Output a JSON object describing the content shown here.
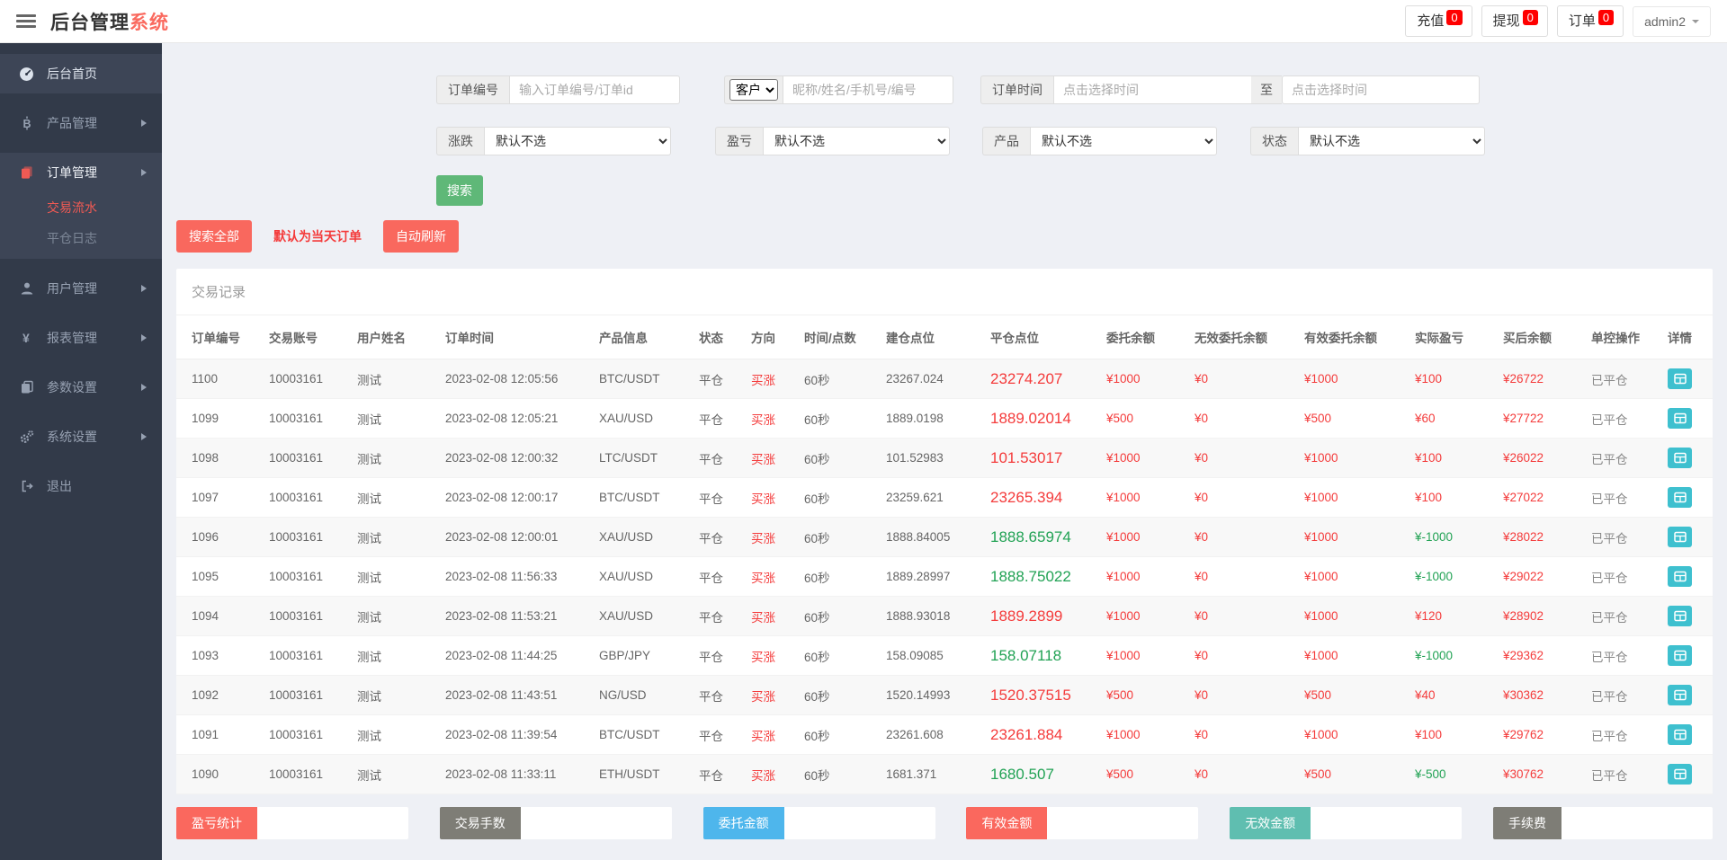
{
  "header": {
    "title_primary": "后台管理",
    "title_accent": "系统",
    "badges": [
      {
        "label": "充值",
        "count": "0"
      },
      {
        "label": "提现",
        "count": "0"
      },
      {
        "label": "订单",
        "count": "0"
      }
    ],
    "user": {
      "name": "admin2"
    }
  },
  "sidebar": {
    "items": [
      {
        "id": "home",
        "label": "后台首页",
        "icon": "dashboard-icon",
        "active": true,
        "has_children": false
      },
      {
        "id": "products",
        "label": "产品管理",
        "icon": "bitcoin-icon",
        "has_children": true
      },
      {
        "id": "orders",
        "label": "订单管理",
        "icon": "orders-icon",
        "has_children": true,
        "expanded": true,
        "children": [
          {
            "label": "交易流水",
            "active": true
          },
          {
            "label": "平仓日志",
            "active": false
          }
        ]
      },
      {
        "id": "users",
        "label": "用户管理",
        "icon": "user-icon",
        "has_children": true
      },
      {
        "id": "reports",
        "label": "报表管理",
        "icon": "yen-icon",
        "has_children": true
      },
      {
        "id": "params",
        "label": "参数设置",
        "icon": "copy-icon",
        "has_children": true
      },
      {
        "id": "system",
        "label": "系统设置",
        "icon": "gears-icon",
        "has_children": true
      },
      {
        "id": "logout",
        "label": "退出",
        "icon": "logout-icon",
        "has_children": false
      }
    ]
  },
  "filters": {
    "order_no_label": "订单编号",
    "order_no_placeholder": "输入订单编号/订单id",
    "customer_select_value": "客户",
    "customer_placeholder": "昵称/姓名/手机号/编号",
    "order_time_label": "订单时间",
    "time_start_placeholder": "点击选择时间",
    "to_label": "至",
    "time_end_placeholder": "点击选择时间",
    "rise_fall_label": "涨跌",
    "profit_label": "盈亏",
    "product_label": "产品",
    "status_label": "状态",
    "default_option": "默认不选",
    "search_button": "搜索"
  },
  "actions": {
    "search_all": "搜索全部",
    "today_note": "默认为当天订单",
    "auto_refresh": "自动刷新"
  },
  "table": {
    "title": "交易记录",
    "columns": [
      "订单编号",
      "交易账号",
      "用户姓名",
      "订单时间",
      "产品信息",
      "状态",
      "方向",
      "时间/点数",
      "建仓点位",
      "平仓点位",
      "委托余额",
      "无效委托余额",
      "有效委托余额",
      "实际盈亏",
      "买后余额",
      "单控操作",
      "详情"
    ],
    "rows": [
      {
        "order_no": "1100",
        "account": "10003161",
        "name": "测试",
        "time": "2023-02-08 12:05:56",
        "product": "BTC/USDT",
        "status": "平仓",
        "direction": "买涨",
        "duration": "60秒",
        "open": "23267.024",
        "close": "23274.207",
        "close_trend": "up",
        "entrust": "¥1000",
        "invalid_entrust": "¥0",
        "valid_entrust": "¥1000",
        "pnl": "¥100",
        "pnl_trend": "up",
        "balance": "¥26722",
        "control": "已平仓"
      },
      {
        "order_no": "1099",
        "account": "10003161",
        "name": "测试",
        "time": "2023-02-08 12:05:21",
        "product": "XAU/USD",
        "status": "平仓",
        "direction": "买涨",
        "duration": "60秒",
        "open": "1889.0198",
        "close": "1889.02014",
        "close_trend": "up",
        "entrust": "¥500",
        "invalid_entrust": "¥0",
        "valid_entrust": "¥500",
        "pnl": "¥60",
        "pnl_trend": "up",
        "balance": "¥27722",
        "control": "已平仓"
      },
      {
        "order_no": "1098",
        "account": "10003161",
        "name": "测试",
        "time": "2023-02-08 12:00:32",
        "product": "LTC/USDT",
        "status": "平仓",
        "direction": "买涨",
        "duration": "60秒",
        "open": "101.52983",
        "close": "101.53017",
        "close_trend": "up",
        "entrust": "¥1000",
        "invalid_entrust": "¥0",
        "valid_entrust": "¥1000",
        "pnl": "¥100",
        "pnl_trend": "up",
        "balance": "¥26022",
        "control": "已平仓"
      },
      {
        "order_no": "1097",
        "account": "10003161",
        "name": "测试",
        "time": "2023-02-08 12:00:17",
        "product": "BTC/USDT",
        "status": "平仓",
        "direction": "买涨",
        "duration": "60秒",
        "open": "23259.621",
        "close": "23265.394",
        "close_trend": "up",
        "entrust": "¥1000",
        "invalid_entrust": "¥0",
        "valid_entrust": "¥1000",
        "pnl": "¥100",
        "pnl_trend": "up",
        "balance": "¥27022",
        "control": "已平仓"
      },
      {
        "order_no": "1096",
        "account": "10003161",
        "name": "测试",
        "time": "2023-02-08 12:00:01",
        "product": "XAU/USD",
        "status": "平仓",
        "direction": "买涨",
        "duration": "60秒",
        "open": "1888.84005",
        "close": "1888.65974",
        "close_trend": "down",
        "entrust": "¥1000",
        "invalid_entrust": "¥0",
        "valid_entrust": "¥1000",
        "pnl": "¥-1000",
        "pnl_trend": "down",
        "balance": "¥28022",
        "control": "已平仓"
      },
      {
        "order_no": "1095",
        "account": "10003161",
        "name": "测试",
        "time": "2023-02-08 11:56:33",
        "product": "XAU/USD",
        "status": "平仓",
        "direction": "买涨",
        "duration": "60秒",
        "open": "1889.28997",
        "close": "1888.75022",
        "close_trend": "down",
        "entrust": "¥1000",
        "invalid_entrust": "¥0",
        "valid_entrust": "¥1000",
        "pnl": "¥-1000",
        "pnl_trend": "down",
        "balance": "¥29022",
        "control": "已平仓"
      },
      {
        "order_no": "1094",
        "account": "10003161",
        "name": "测试",
        "time": "2023-02-08 11:53:21",
        "product": "XAU/USD",
        "status": "平仓",
        "direction": "买涨",
        "duration": "60秒",
        "open": "1888.93018",
        "close": "1889.2899",
        "close_trend": "up",
        "entrust": "¥1000",
        "invalid_entrust": "¥0",
        "valid_entrust": "¥1000",
        "pnl": "¥120",
        "pnl_trend": "up",
        "balance": "¥28902",
        "control": "已平仓"
      },
      {
        "order_no": "1093",
        "account": "10003161",
        "name": "测试",
        "time": "2023-02-08 11:44:25",
        "product": "GBP/JPY",
        "status": "平仓",
        "direction": "买涨",
        "duration": "60秒",
        "open": "158.09085",
        "close": "158.07118",
        "close_trend": "down",
        "entrust": "¥1000",
        "invalid_entrust": "¥0",
        "valid_entrust": "¥1000",
        "pnl": "¥-1000",
        "pnl_trend": "down",
        "balance": "¥29362",
        "control": "已平仓"
      },
      {
        "order_no": "1092",
        "account": "10003161",
        "name": "测试",
        "time": "2023-02-08 11:43:51",
        "product": "NG/USD",
        "status": "平仓",
        "direction": "买涨",
        "duration": "60秒",
        "open": "1520.14993",
        "close": "1520.37515",
        "close_trend": "up",
        "entrust": "¥500",
        "invalid_entrust": "¥0",
        "valid_entrust": "¥500",
        "pnl": "¥40",
        "pnl_trend": "up",
        "balance": "¥30362",
        "control": "已平仓"
      },
      {
        "order_no": "1091",
        "account": "10003161",
        "name": "测试",
        "time": "2023-02-08 11:39:54",
        "product": "BTC/USDT",
        "status": "平仓",
        "direction": "买涨",
        "duration": "60秒",
        "open": "23261.608",
        "close": "23261.884",
        "close_trend": "up",
        "entrust": "¥1000",
        "invalid_entrust": "¥0",
        "valid_entrust": "¥1000",
        "pnl": "¥100",
        "pnl_trend": "up",
        "balance": "¥29762",
        "control": "已平仓"
      },
      {
        "order_no": "1090",
        "account": "10003161",
        "name": "测试",
        "time": "2023-02-08 11:33:11",
        "product": "ETH/USDT",
        "status": "平仓",
        "direction": "买涨",
        "duration": "60秒",
        "open": "1681.371",
        "close": "1680.507",
        "close_trend": "down",
        "entrust": "¥500",
        "invalid_entrust": "¥0",
        "valid_entrust": "¥500",
        "pnl": "¥-500",
        "pnl_trend": "down",
        "balance": "¥30762",
        "control": "已平仓"
      }
    ]
  },
  "summary": [
    {
      "label": "盈亏统计",
      "value": "",
      "color": "#fa685e"
    },
    {
      "label": "交易手数",
      "value": "",
      "color": "#7e7d76"
    },
    {
      "label": "委托金额",
      "value": "",
      "color": "#4eb6ec"
    },
    {
      "label": "有效金额",
      "value": "",
      "color": "#fa685e"
    },
    {
      "label": "无效金额",
      "value": "",
      "color": "#5fbeb0"
    },
    {
      "label": "手续费",
      "value": "",
      "color": "#7e7d76"
    }
  ],
  "colors": {
    "gain_red": "#f43b3b",
    "loss_green": "#21a254",
    "salmon_button": "#f9685e",
    "green_button": "#5fb878",
    "badge_red": "#ff0000",
    "detail_teal": "#3ec0cf",
    "sidebar_bg": "#323a49",
    "sidebar_active_bg": "#3d4556",
    "page_bg": "#eef0f5"
  }
}
